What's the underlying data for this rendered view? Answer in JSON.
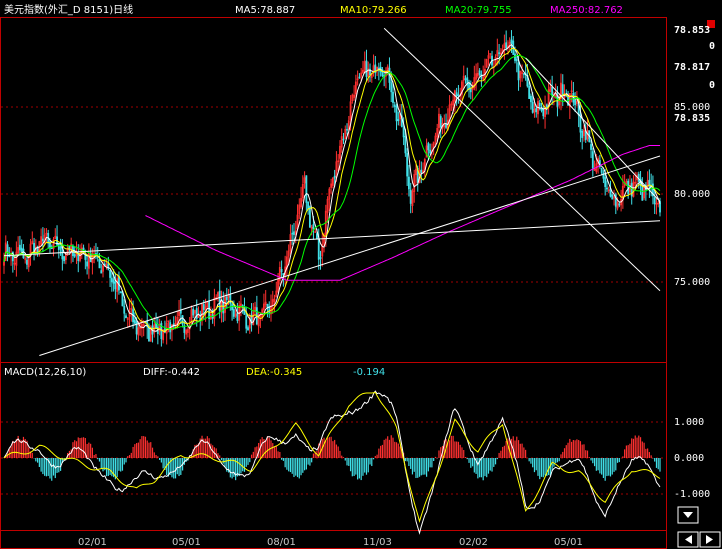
{
  "header": {
    "title": "美元指数(外汇_D 8151)日线",
    "ma5": "MA5:78.887",
    "ma10": "MA10:79.266",
    "ma20": "MA20:79.755",
    "ma250": "MA250:82.762"
  },
  "colors": {
    "background": "#000000",
    "border": "#c00000",
    "grid": "#a00000",
    "up": "#ff3030",
    "down": "#40e0e8",
    "ma5": "#ffffff",
    "ma10": "#ffff00",
    "ma20": "#00ff00",
    "ma250": "#ff00ff",
    "trend": "#ffffff",
    "diff": "#ffffff",
    "dea": "#ffff00",
    "text_header": "#ffffff",
    "text_ma5": "#ffffff",
    "text_ma10": "#ffff00",
    "text_ma20": "#00ff00",
    "text_ma250": "#ff00ff",
    "axis_text": "#ffffff",
    "date_text": "#c8c8c8",
    "macd_value": "#40e0e8"
  },
  "price_axis": {
    "labels": [
      "85.000",
      "80.000",
      "75.000"
    ],
    "top_values": [
      "78.853",
      "0",
      "78.817",
      "0",
      "78.835"
    ]
  },
  "macd_header": {
    "label": "MACD(12,26,10)",
    "diff": "DIFF:-0.442",
    "dea": "DEA:-0.345",
    "macd": "-0.194"
  },
  "macd_axis": {
    "labels": [
      "1.000",
      "0.000",
      "-1.000"
    ]
  },
  "date_labels": [
    "02/01",
    "05/01",
    "08/01",
    "11/03",
    "02/02",
    "05/01"
  ],
  "icons": {
    "scroll_down": "down-arrow-icon",
    "scroll_left": "left-arrow-icon",
    "scroll_right": "right-arrow-icon",
    "corner": "corner-marker-icon"
  },
  "chart_data": {
    "type": "candlestick",
    "title": "美元指数(外汇_D 8151)日线",
    "xlabel": "",
    "ylabel": "",
    "ylim": [
      70.6,
      89.0
    ],
    "x_ticks": [
      "02/01",
      "05/01",
      "08/01",
      "11/03",
      "02/02",
      "05/01"
    ],
    "price_path": [
      {
        "i": 0,
        "v": 76.6
      },
      {
        "i": 12,
        "v": 76.4
      },
      {
        "i": 22,
        "v": 77.4
      },
      {
        "i": 30,
        "v": 76.9
      },
      {
        "i": 40,
        "v": 76.6
      },
      {
        "i": 50,
        "v": 76.5
      },
      {
        "i": 60,
        "v": 75.6
      },
      {
        "i": 70,
        "v": 72.9
      },
      {
        "i": 80,
        "v": 72.3
      },
      {
        "i": 95,
        "v": 72.4
      },
      {
        "i": 110,
        "v": 73.2
      },
      {
        "i": 125,
        "v": 73.9
      },
      {
        "i": 140,
        "v": 72.8
      },
      {
        "i": 150,
        "v": 73.4
      },
      {
        "i": 160,
        "v": 76.4
      },
      {
        "i": 170,
        "v": 80.3
      },
      {
        "i": 178,
        "v": 76.3
      },
      {
        "i": 185,
        "v": 80.6
      },
      {
        "i": 200,
        "v": 86.6
      },
      {
        "i": 215,
        "v": 87.5
      },
      {
        "i": 225,
        "v": 83.6
      },
      {
        "i": 230,
        "v": 80.0
      },
      {
        "i": 240,
        "v": 82.6
      },
      {
        "i": 255,
        "v": 85.6
      },
      {
        "i": 270,
        "v": 86.8
      },
      {
        "i": 285,
        "v": 88.6
      },
      {
        "i": 295,
        "v": 86.3
      },
      {
        "i": 300,
        "v": 84.6
      },
      {
        "i": 310,
        "v": 85.6
      },
      {
        "i": 320,
        "v": 85.9
      },
      {
        "i": 335,
        "v": 81.6
      },
      {
        "i": 345,
        "v": 79.6
      },
      {
        "i": 355,
        "v": 80.6
      },
      {
        "i": 365,
        "v": 80.2
      },
      {
        "i": 371,
        "v": 79.0
      }
    ],
    "ma250_path": [
      {
        "i": 80,
        "v": 78.8
      },
      {
        "i": 120,
        "v": 76.8
      },
      {
        "i": 160,
        "v": 75.1
      },
      {
        "i": 190,
        "v": 75.1
      },
      {
        "i": 220,
        "v": 76.4
      },
      {
        "i": 250,
        "v": 77.8
      },
      {
        "i": 280,
        "v": 79.1
      },
      {
        "i": 320,
        "v": 80.8
      },
      {
        "i": 350,
        "v": 82.3
      },
      {
        "i": 365,
        "v": 82.8
      }
    ],
    "macd_path": [
      {
        "i": 0,
        "v": 0.0
      },
      {
        "i": 20,
        "v": 0.3
      },
      {
        "i": 40,
        "v": -0.1
      },
      {
        "i": 60,
        "v": -0.4
      },
      {
        "i": 75,
        "v": -0.9
      },
      {
        "i": 85,
        "v": -0.6
      },
      {
        "i": 100,
        "v": 0.1
      },
      {
        "i": 120,
        "v": 0.0
      },
      {
        "i": 140,
        "v": -0.3
      },
      {
        "i": 165,
        "v": 0.9
      },
      {
        "i": 178,
        "v": 0.1
      },
      {
        "i": 195,
        "v": 1.5
      },
      {
        "i": 210,
        "v": 1.9
      },
      {
        "i": 222,
        "v": 0.8
      },
      {
        "i": 235,
        "v": -1.8
      },
      {
        "i": 255,
        "v": 1.0
      },
      {
        "i": 268,
        "v": 0.2
      },
      {
        "i": 282,
        "v": 1.0
      },
      {
        "i": 295,
        "v": -1.5
      },
      {
        "i": 310,
        "v": -0.2
      },
      {
        "i": 325,
        "v": -0.4
      },
      {
        "i": 340,
        "v": -1.2
      },
      {
        "i": 355,
        "v": -0.3
      },
      {
        "i": 371,
        "v": -0.5
      }
    ],
    "trendlines": [
      {
        "from": {
          "i": 0,
          "v": 76.5
        },
        "to": {
          "i": 371,
          "v": 78.5
        }
      },
      {
        "from": {
          "i": 20,
          "v": 70.8
        },
        "to": {
          "i": 371,
          "v": 82.2
        }
      },
      {
        "from": {
          "i": 215,
          "v": 89.5
        },
        "to": {
          "i": 371,
          "v": 74.5
        }
      },
      {
        "from": {
          "i": 295,
          "v": 87.8
        },
        "to": {
          "i": 371,
          "v": 79.6
        }
      }
    ]
  }
}
